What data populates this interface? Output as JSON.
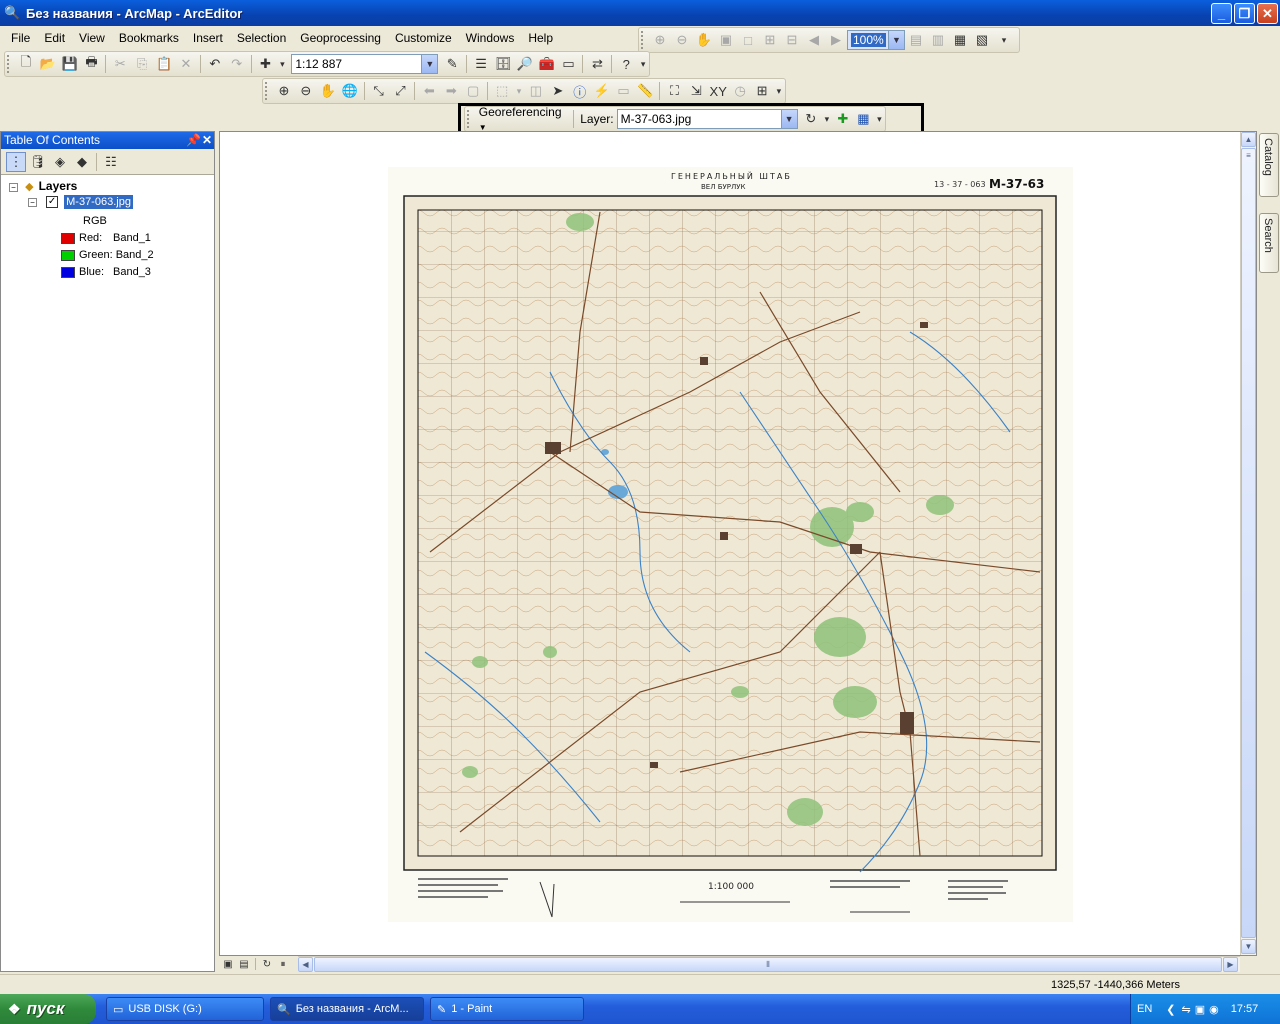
{
  "window": {
    "title": "Без названия - ArcMap - ArcEditor"
  },
  "menu": [
    "File",
    "Edit",
    "View",
    "Bookmarks",
    "Insert",
    "Selection",
    "Geoprocessing",
    "Customize",
    "Windows",
    "Help"
  ],
  "standard_toolbar": {
    "scale": "1:12 887"
  },
  "layout_toolbar": {
    "zoom": "100%"
  },
  "georef_toolbar": {
    "menu_label": "Georeferencing",
    "layer_label": "Layer:",
    "layer_value": "M-37-063.jpg"
  },
  "toc": {
    "title": "Table Of Contents",
    "root": "Layers",
    "layer": "M-37-063.jpg",
    "render": "RGB",
    "bands": [
      {
        "label": "Red:",
        "band": "Band_1",
        "color": "#e00000"
      },
      {
        "label": "Green:",
        "band": "Band_2",
        "color": "#00d000"
      },
      {
        "label": "Blue:",
        "band": "Band_3",
        "color": "#0000e0"
      }
    ]
  },
  "map": {
    "header": "ГЕНЕРАЛЬНЫЙ ШТАБ",
    "subheader": "ВЕЛ БУРЛУК",
    "sheet_id": "М-37-63",
    "sheet_id_small": "13 - 37 - 063",
    "scale_text": "1:100 000"
  },
  "right_dock": {
    "tabs": [
      "Catalog",
      "Search"
    ]
  },
  "status": {
    "coords": "1325,57  -1440,366 Meters"
  },
  "taskbar": {
    "start": "пуск",
    "tasks": [
      "USB DISK (G:)",
      "Без названия - ArcM...",
      "1 - Paint"
    ],
    "lang": "EN",
    "clock": "17:57"
  }
}
